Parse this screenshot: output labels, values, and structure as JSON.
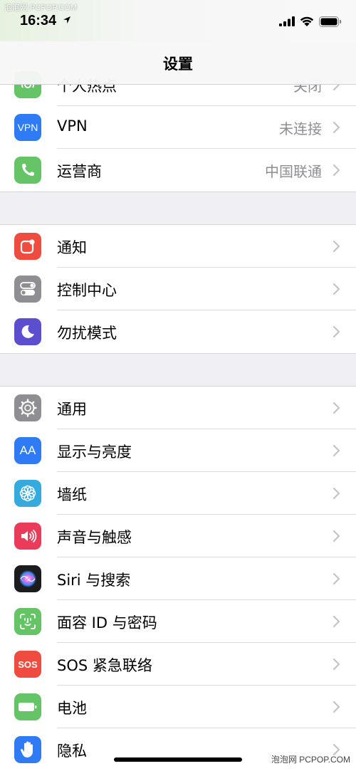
{
  "watermark": {
    "top": "泡泡网 PCPOP.COM",
    "bottom": "泡泡网 PCPOP.COM"
  },
  "status_bar": {
    "time": "16:34"
  },
  "nav": {
    "title": "设置"
  },
  "sections": [
    {
      "items": [
        {
          "label": "个人热点",
          "value": "关闭",
          "icon": "hotspot-icon",
          "color": "#65c466"
        },
        {
          "label": "VPN",
          "value": "未连接",
          "icon": "vpn-icon",
          "icon_text": "VPN",
          "color": "#2f7bf5"
        },
        {
          "label": "运营商",
          "value": "中国联通",
          "icon": "phone-icon",
          "color": "#65c466"
        }
      ]
    },
    {
      "items": [
        {
          "label": "通知",
          "icon": "notifications-icon",
          "color": "#ef4b3f"
        },
        {
          "label": "控制中心",
          "icon": "control-center-icon",
          "color": "#8e8e93"
        },
        {
          "label": "勿扰模式",
          "icon": "moon-icon",
          "color": "#5b4fcf"
        }
      ]
    },
    {
      "items": [
        {
          "label": "通用",
          "icon": "gear-icon",
          "color": "#8e8e93"
        },
        {
          "label": "显示与亮度",
          "icon": "display-icon",
          "icon_text": "AA",
          "color": "#2f7bf5"
        },
        {
          "label": "墙纸",
          "icon": "wallpaper-icon",
          "color": "#35aadc"
        },
        {
          "label": "声音与触感",
          "icon": "speaker-icon",
          "color": "#ea3b5a"
        },
        {
          "label": "Siri 与搜索",
          "icon": "siri-icon",
          "color": "#1c1c1e"
        },
        {
          "label": "面容 ID 与密码",
          "icon": "face-id-icon",
          "color": "#65c466"
        },
        {
          "label": "SOS 紧急联络",
          "icon": "sos-icon",
          "icon_text": "SOS",
          "color": "#ef4b3f"
        },
        {
          "label": "电池",
          "icon": "battery-icon",
          "color": "#65c466"
        },
        {
          "label": "隐私",
          "icon": "hand-icon",
          "color": "#2f7bf5"
        }
      ]
    }
  ]
}
